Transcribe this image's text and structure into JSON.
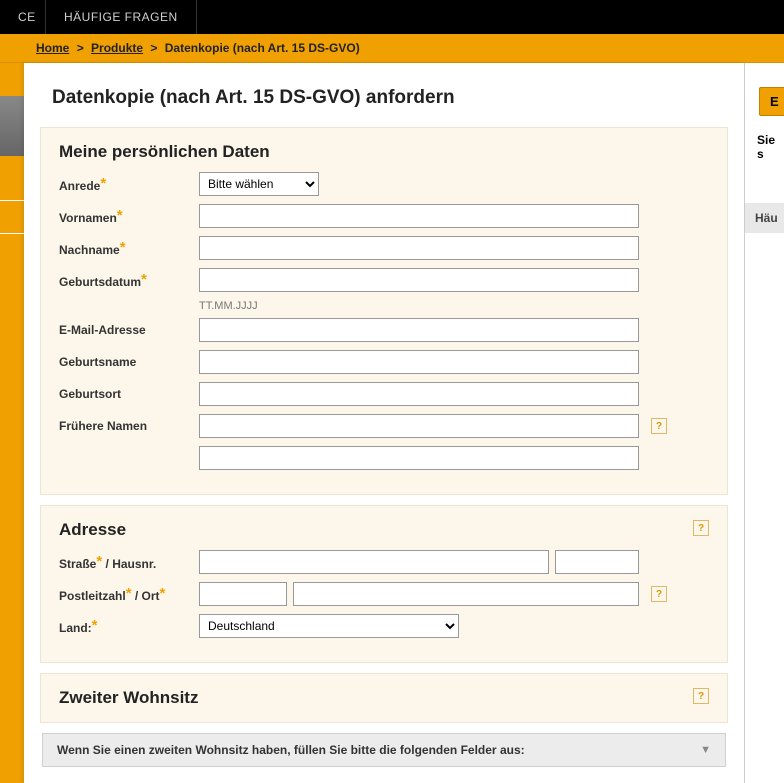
{
  "topbar": {
    "tab1": "CE",
    "tab2": "HÄUFIGE FRAGEN"
  },
  "breadcrumb": {
    "home": "Home",
    "produkte": "Produkte",
    "current": "Datenkopie (nach Art. 15 DS-GVO)",
    "sep": ">"
  },
  "page": {
    "title": "Datenkopie (nach Art. 15 DS-GVO) anfordern"
  },
  "personal": {
    "title": "Meine persönlichen Daten",
    "anrede_label": "Anrede",
    "anrede_placeholder": "Bitte wählen",
    "vornamen_label": "Vornamen",
    "nachname_label": "Nachname",
    "geburtsdatum_label": "Geburtsdatum",
    "geburtsdatum_hint": "TT.MM.JJJJ",
    "email_label": "E-Mail-Adresse",
    "geburtsname_label": "Geburtsname",
    "geburtsort_label": "Geburtsort",
    "fruehere_label": "Frühere Namen"
  },
  "adresse": {
    "title": "Adresse",
    "strasse_label_a": "Straße",
    "strasse_label_b": " / Hausnr.",
    "plz_label_a": "Postleitzahl",
    "plz_label_b": " / Ort",
    "land_label": "Land:",
    "land_value": "Deutschland"
  },
  "zweiter": {
    "title": "Zweiter Wohnsitz",
    "collapse_text": "Wenn Sie einen zweiten Wohnsitz haben, füllen Sie bitte die folgenden Felder aus:"
  },
  "right": {
    "btn_e": "E",
    "sie": "Sie s",
    "hau": "Häu"
  },
  "help": "?"
}
